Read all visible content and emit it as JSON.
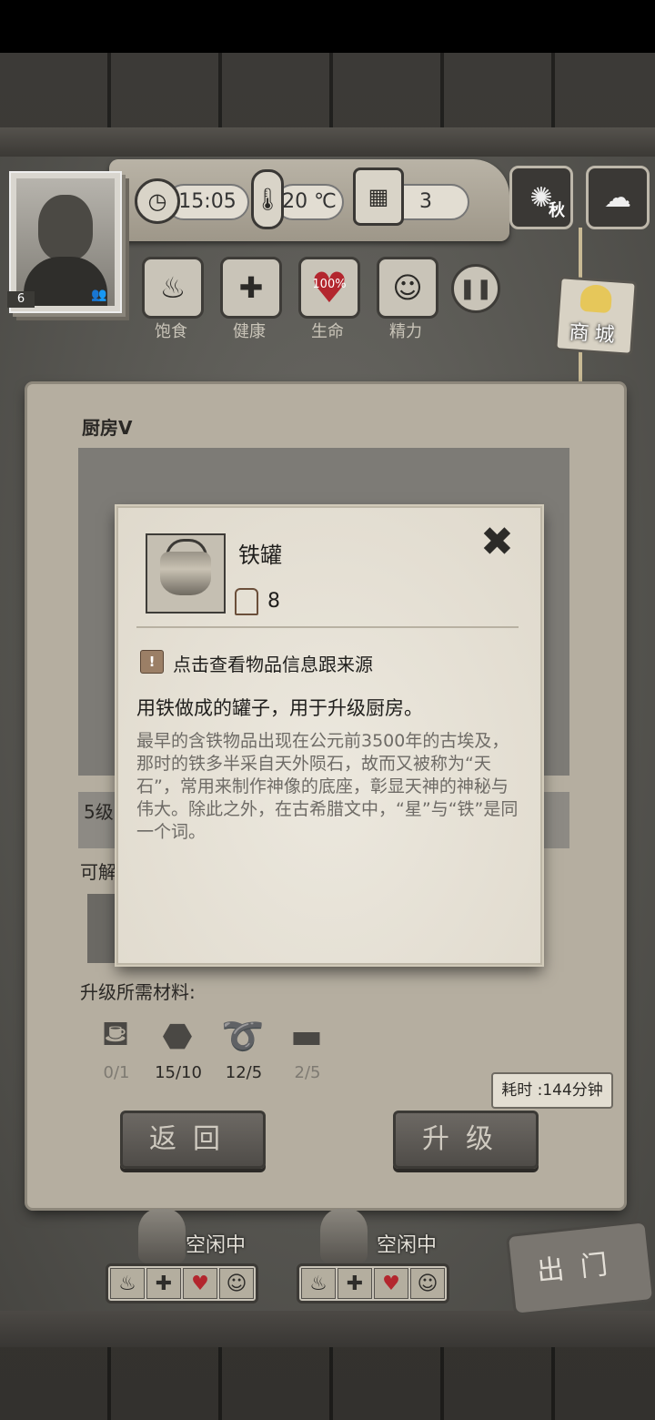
{
  "status_bar": {},
  "header": {
    "time": "15:05",
    "temperature": "20 ℃",
    "day": "3",
    "season_label": "秋",
    "player_level": "6"
  },
  "stats": {
    "food_label": "饱食",
    "health_label": "健康",
    "life_label": "生命",
    "life_value": "100%",
    "energy_label": "精力"
  },
  "shop": {
    "label": "商城"
  },
  "panel": {
    "title": "厨房V",
    "level_text": "5级",
    "unlock_text": "可解",
    "materials_title": "升级所需材料:",
    "materials": [
      {
        "name": "iron-pot",
        "count": "0/1",
        "enough": false
      },
      {
        "name": "stone",
        "count": "15/10",
        "enough": true
      },
      {
        "name": "rope",
        "count": "12/5",
        "enough": true
      },
      {
        "name": "iron-bar",
        "count": "2/5",
        "enough": false
      }
    ],
    "time_cost": "耗时 :144分钟",
    "back_button": "返回",
    "upgrade_button": "升级"
  },
  "characters": [
    {
      "status": "空闲中"
    },
    {
      "status": "空闲中"
    }
  ],
  "exit_label": "出门",
  "popup": {
    "item_name": "铁罐",
    "item_weight": "8",
    "info_link": "点击查看物品信息跟来源",
    "usage": "用铁做成的罐子，用于升级厨房。",
    "lore": "最早的含铁物品出现在公元前3500年的古埃及，那时的铁多半采自天外陨石，故而又被称为“天石”，常用来制作神像的底座，彰显天神的神秘与伟大。除此之外，在古希腊文中，“星”与“铁”是同一个词。"
  },
  "colors": {
    "heart": "#b3262e",
    "parchment": "#e8e3d7"
  }
}
